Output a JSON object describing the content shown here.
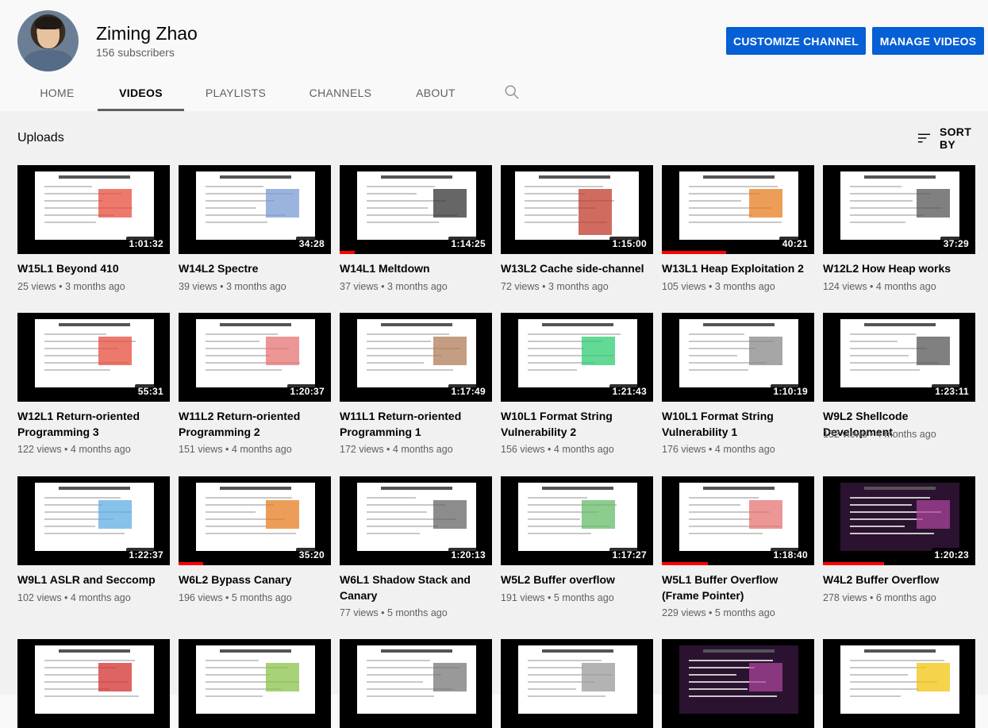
{
  "channel": {
    "name": "Ziming Zhao",
    "subscribers": "156 subscribers"
  },
  "buttons": {
    "customize": "CUSTOMIZE CHANNEL",
    "manage": "MANAGE VIDEOS"
  },
  "tabs": [
    "HOME",
    "VIDEOS",
    "PLAYLISTS",
    "CHANNELS",
    "ABOUT"
  ],
  "active_tab": "VIDEOS",
  "section": {
    "title": "Uploads",
    "sort_label": "SORT BY"
  },
  "videos": [
    {
      "title": "W15L1 Beyond 410",
      "meta": "25 views • 3 months ago",
      "duration": "1:01:32",
      "progress": 0
    },
    {
      "title": "W14L2 Spectre",
      "meta": "39 views • 3 months ago",
      "duration": "34:28",
      "progress": 0
    },
    {
      "title": "W14L1 Meltdown",
      "meta": "37 views • 3 months ago",
      "duration": "1:14:25",
      "progress": 0.1
    },
    {
      "title": "W13L2 Cache side-channel",
      "meta": "72 views • 3 months ago",
      "duration": "1:15:00",
      "progress": 0
    },
    {
      "title": "W13L1 Heap Exploitation 2",
      "meta": "105 views • 3 months ago",
      "duration": "40:21",
      "progress": 0.42
    },
    {
      "title": "W12L2 How Heap works",
      "meta": "124 views • 4 months ago",
      "duration": "37:29",
      "progress": 0
    },
    {
      "title": "W12L1 Return-oriented Programming 3",
      "meta": "122 views • 4 months ago",
      "duration": "55:31",
      "progress": 0
    },
    {
      "title": "W11L2 Return-oriented Programming 2",
      "meta": "151 views • 4 months ago",
      "duration": "1:20:37",
      "progress": 0
    },
    {
      "title": "W11L1 Return-oriented Programming 1",
      "meta": "172 views • 4 months ago",
      "duration": "1:17:49",
      "progress": 0
    },
    {
      "title": "W10L1 Format String Vulnerability 2",
      "meta": "156 views • 4 months ago",
      "duration": "1:21:43",
      "progress": 0
    },
    {
      "title": "W10L1 Format String Vulnerability 1",
      "meta": "176 views • 4 months ago",
      "duration": "1:10:19",
      "progress": 0
    },
    {
      "title": "W9L2 Shellcode Development",
      "meta": "132 views • 4 months ago",
      "duration": "1:23:11",
      "progress": 0
    },
    {
      "title": "W9L1 ASLR and Seccomp",
      "meta": "102 views • 4 months ago",
      "duration": "1:22:37",
      "progress": 0
    },
    {
      "title": "W6L2 Bypass Canary",
      "meta": "196 views • 5 months ago",
      "duration": "35:20",
      "progress": 0.16
    },
    {
      "title": "W6L1 Shadow Stack and Canary",
      "meta": "77 views • 5 months ago",
      "duration": "1:20:13",
      "progress": 0
    },
    {
      "title": "W5L2 Buffer overflow",
      "meta": "191 views • 5 months ago",
      "duration": "1:17:27",
      "progress": 0
    },
    {
      "title": "W5L1 Buffer Overflow (Frame Pointer)",
      "meta": "229 views • 5 months ago",
      "duration": "1:18:40",
      "progress": 0.3
    },
    {
      "title": "W4L2 Buffer Overflow",
      "meta": "278 views • 6 months ago",
      "duration": "1:20:23",
      "progress": 0.4
    },
    {
      "title": "",
      "meta": "",
      "duration": "",
      "progress": 0
    },
    {
      "title": "",
      "meta": "",
      "duration": "",
      "progress": 0
    },
    {
      "title": "",
      "meta": "",
      "duration": "",
      "progress": 0
    },
    {
      "title": "",
      "meta": "",
      "duration": "",
      "progress": 0
    },
    {
      "title": "",
      "meta": "",
      "duration": "",
      "progress": 0
    },
    {
      "title": "",
      "meta": "",
      "duration": "",
      "progress": 0
    }
  ],
  "icons": {
    "search": "search-icon",
    "sort": "sort-icon"
  },
  "colors": {
    "primary_button": "#065fd4",
    "progress": "#ff0000"
  }
}
